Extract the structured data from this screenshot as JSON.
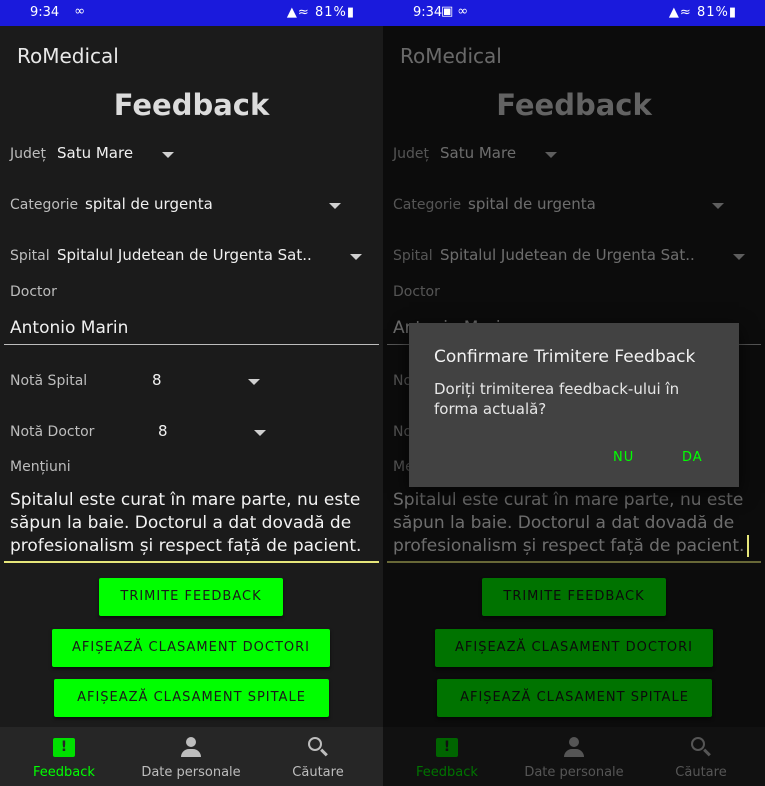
{
  "status": {
    "time": "9:34",
    "battery": "81%"
  },
  "app_name": "RoMedical",
  "page_title": "Feedback",
  "form": {
    "county": {
      "label": "Județ",
      "value": "Satu Mare"
    },
    "category": {
      "label": "Categorie",
      "value": "spital de urgenta"
    },
    "hospital": {
      "label": "Spital",
      "value": "Spitalul Judetean de Urgenta Sat.."
    },
    "doctor": {
      "label": "Doctor",
      "value": "Antonio Marin"
    },
    "hospital_rating": {
      "label": "Notă Spital",
      "value": "8"
    },
    "doctor_rating": {
      "label": "Notă Doctor",
      "value": "8"
    },
    "mentions": {
      "label": "Mențiuni",
      "value": "Spitalul este curat în mare parte, nu este săpun la baie. Doctorul a dat dovadă de profesionalism și respect față de pacient."
    }
  },
  "buttons": {
    "send": "TRIMITE FEEDBACK",
    "doctors_ranking": "AFIȘEAZĂ CLASAMENT DOCTORI",
    "hospitals_ranking": "AFIȘEAZĂ CLASAMENT SPITALE"
  },
  "nav": {
    "feedback": "Feedback",
    "personal": "Date personale",
    "search": "Căutare"
  },
  "dialog": {
    "title": "Confirmare Trimitere Feedback",
    "message": "Doriți trimiterea feedback-ului în forma actuală?",
    "no": "NU",
    "yes": "DA"
  },
  "colors": {
    "accent": "#00ff00",
    "statusbar": "#1a1adc",
    "background": "#1b1b1b"
  }
}
